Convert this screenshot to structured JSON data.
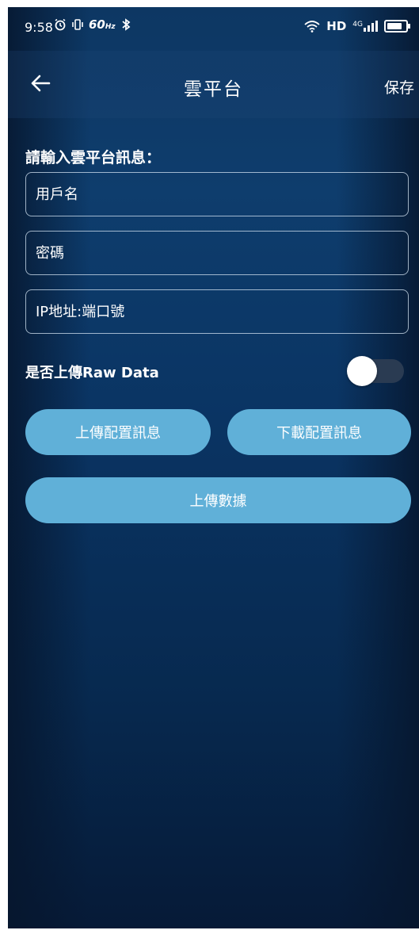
{
  "status_bar": {
    "time": "9:58",
    "refresh_rate": "60",
    "refresh_unit": "Hz",
    "hd": "HD",
    "network": "4G",
    "icons": [
      "alarm-icon",
      "vibrate-icon",
      "bluetooth-icon",
      "wifi-icon",
      "signal-icon",
      "battery-icon"
    ]
  },
  "header": {
    "title": "雲平台",
    "save_label": "保存",
    "back_icon": "arrow-left-icon"
  },
  "form": {
    "section_label": "請輸入雲平台訊息：",
    "username_placeholder": "用戶名",
    "password_placeholder": "密碼",
    "address_placeholder": "IP地址:端口號"
  },
  "raw_data": {
    "label": "是否上傳Raw Data",
    "enabled": false
  },
  "actions": {
    "upload_config": "上傳配置訊息",
    "download_config": "下載配置訊息",
    "upload_data": "上傳數據"
  },
  "colors": {
    "background": "#0a3463",
    "button": "#60b0d8",
    "toggle_track": "#2a3b52"
  }
}
